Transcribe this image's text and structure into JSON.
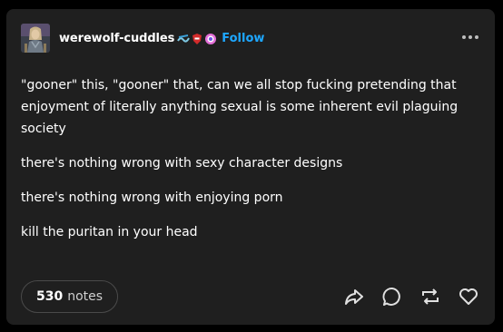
{
  "post": {
    "blog_name": "werewolf-cuddles",
    "follow_label": "Follow",
    "badges": [
      "wave-badge-icon",
      "red-shield-badge-icon",
      "pink-gear-badge-icon"
    ],
    "paragraphs": [
      "\"gooner\" this, \"gooner\" that, can we all stop fucking pretending that enjoyment of literally anything sexual is some inherent evil plaguing society",
      "there's nothing wrong with sexy character designs",
      "there's nothing wrong with enjoying porn",
      "kill the puritan in your head"
    ],
    "notes_count": "530",
    "notes_label": "notes",
    "actions": [
      "share-icon",
      "reply-icon",
      "reblog-icon",
      "like-icon"
    ]
  },
  "colors": {
    "card_bg": "#1f1f1f",
    "page_bg": "#000000",
    "follow": "#1ea7ff",
    "text": "#ffffff"
  }
}
